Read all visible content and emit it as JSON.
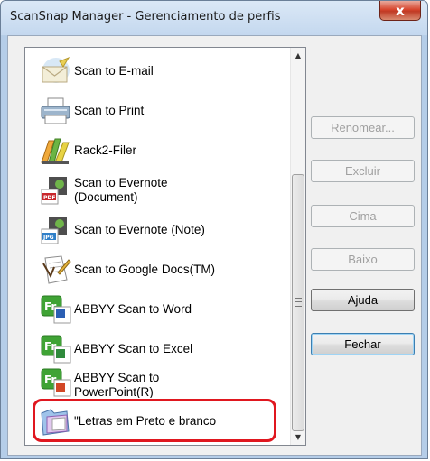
{
  "window": {
    "title": "ScanSnap Manager - Gerenciamento de perfis",
    "close_glyph": "x"
  },
  "profiles": [
    {
      "label": "Scan to E-mail",
      "icon": "email-envelope-icon"
    },
    {
      "label": "Scan to Print",
      "icon": "printer-icon"
    },
    {
      "label": "Rack2-Filer",
      "icon": "rack2-filer-icon"
    },
    {
      "label": "Scan to Evernote\n(Document)",
      "icon": "evernote-pdf-icon"
    },
    {
      "label": "Scan to Evernote (Note)",
      "icon": "evernote-jpg-icon"
    },
    {
      "label": "Scan to Google Docs(TM)",
      "icon": "google-docs-icon"
    },
    {
      "label": "ABBYY Scan to Word",
      "icon": "abbyy-word-icon"
    },
    {
      "label": "ABBYY Scan to Excel",
      "icon": "abbyy-excel-icon"
    },
    {
      "label": "ABBYY Scan to\nPowerPoint(R)",
      "icon": "abbyy-powerpoint-icon"
    },
    {
      "label": "\"Letras em Preto e branco",
      "icon": "custom-profile-folder-icon"
    }
  ],
  "buttons": {
    "rename": "Renomear...",
    "delete": "Excluir",
    "up": "Cima",
    "down": "Baixo",
    "help": "Ajuda",
    "close": "Fechar"
  },
  "colors": {
    "highlight": "#e0171f",
    "disabled_text": "#a0a0a0"
  }
}
